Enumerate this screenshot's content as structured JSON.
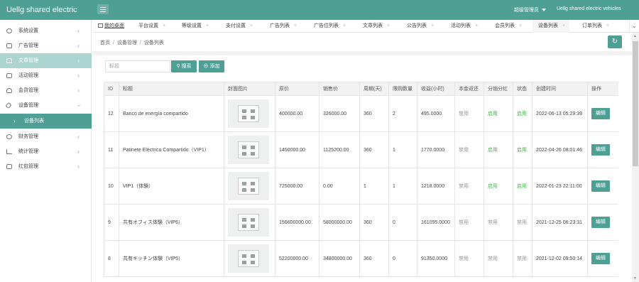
{
  "app": {
    "brand": "Uellg shared electric",
    "admin_label": "超级管理员",
    "site_name": "Uellg shared electric vehicles"
  },
  "sidebar": {
    "items": [
      {
        "label": "系统设置",
        "icon": "gear-icon"
      },
      {
        "label": "广告管理",
        "icon": "image-icon"
      },
      {
        "label": "文章管理",
        "icon": "users-icon",
        "active": true
      },
      {
        "label": "活动管理",
        "icon": "calendar-icon"
      },
      {
        "label": "会员管理",
        "icon": "user-icon"
      },
      {
        "label": "设备管理",
        "icon": "tools-icon"
      },
      {
        "label": "财务管理",
        "icon": "dollar-icon"
      },
      {
        "label": "统计管理",
        "icon": "chart-icon"
      },
      {
        "label": "红包管理",
        "icon": "gift-icon"
      }
    ],
    "sub_item": "设备列表"
  },
  "tabs": {
    "items": [
      "我的桌面",
      "平台设置",
      "等级设置",
      "支付设置",
      "广告列表",
      "广告位列表",
      "文章列表",
      "公告列表",
      "活动列表",
      "会员列表",
      "设备列表",
      "订单列表"
    ],
    "active": "设备列表"
  },
  "breadcrumb": [
    "首页",
    "设备管理",
    "设备列表"
  ],
  "search": {
    "placeholder": "标题",
    "search_label": "搜索",
    "add_label": "添加"
  },
  "table": {
    "columns": [
      "ID",
      "标题",
      "封面图片",
      "原价",
      "销售价",
      "周期(天)",
      "限购数量",
      "收益(小时)",
      "本金返还",
      "分销分红",
      "状态",
      "创建时间",
      "操作"
    ],
    "rows": [
      {
        "id": "12",
        "title": "Banco de energía compartido",
        "orig": "400000.00",
        "price": "326000.00",
        "period": "360",
        "limit": "2",
        "profit": "495.0000",
        "refund": "禁用",
        "refund_on": false,
        "dist": "启用",
        "dist_on": true,
        "status": "启用",
        "status_on": true,
        "created": "2022-06-13 05:29:39",
        "op": "编辑"
      },
      {
        "id": "11",
        "title": "Patinete Eléctrico Compartido（VIP1）",
        "orig": "1450000.00",
        "price": "1125200.00",
        "period": "360",
        "limit": "1",
        "profit": "1770.0000",
        "refund": "禁用",
        "refund_on": false,
        "dist": "启用",
        "dist_on": true,
        "status": "启用",
        "status_on": true,
        "created": "2022-04-26 08:01:46",
        "op": "编辑"
      },
      {
        "id": "10",
        "title": "VIP1（体験）",
        "orig": "725000.00",
        "price": "0.00",
        "period": "1",
        "limit": "1",
        "profit": "1218.0000",
        "refund": "禁用",
        "refund_on": false,
        "dist": "启用",
        "dist_on": true,
        "status": "启用",
        "status_on": true,
        "created": "2022-01-23 22:11:00",
        "op": "编辑"
      },
      {
        "id": "9",
        "title": "共有オフィス体験（VIP6）",
        "orig": "156600000.00",
        "price": "58000000.00",
        "period": "360",
        "limit": "0",
        "profit": "161095.0000",
        "refund": "禁用",
        "refund_on": false,
        "dist": "禁用",
        "dist_on": false,
        "status": "禁用",
        "status_on": false,
        "created": "2021-12-25 06:23:31",
        "op": "编辑"
      },
      {
        "id": "8",
        "title": "共有キッチン体験（VIP5）",
        "orig": "52200000.00",
        "price": "34800000.00",
        "period": "360",
        "limit": "0",
        "profit": "91350.0000",
        "refund": "禁用",
        "refund_on": false,
        "dist": "禁用",
        "dist_on": false,
        "status": "禁用",
        "status_on": false,
        "created": "2021-12-02 09:50:14",
        "op": "编辑"
      }
    ]
  },
  "colors": {
    "primary": "#4e9f94",
    "enabled": "#4caf50",
    "disabled": "#999999"
  }
}
